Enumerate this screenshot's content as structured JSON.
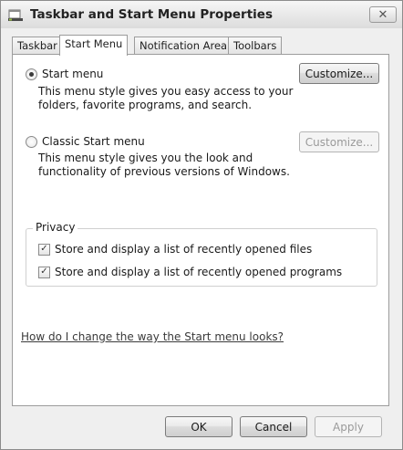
{
  "window": {
    "title": "Taskbar and Start Menu Properties",
    "close_glyph": "✕"
  },
  "tabs": [
    {
      "label": "Taskbar",
      "active": false
    },
    {
      "label": "Start Menu",
      "active": true
    },
    {
      "label": "Notification Area",
      "active": false
    },
    {
      "label": "Toolbars",
      "active": false
    }
  ],
  "start_menu": {
    "option_start": {
      "label": "Start menu",
      "selected": true,
      "description_line1": "This menu style gives you easy access to your",
      "description_line2": "folders, favorite programs, and search.",
      "customize_label": "Customize...",
      "customize_enabled": true
    },
    "option_classic": {
      "label": "Classic Start menu",
      "selected": false,
      "description_line1": "This menu style gives you the look and",
      "description_line2": "functionality of previous versions of Windows.",
      "customize_label": "Customize...",
      "customize_enabled": false
    },
    "privacy": {
      "title": "Privacy",
      "checkboxes": [
        {
          "label": "Store and display a list of recently opened files",
          "checked": true
        },
        {
          "label": "Store and display a list of recently opened programs",
          "checked": true
        }
      ]
    },
    "help_link": "How do I change the way the Start menu looks?"
  },
  "footer": {
    "ok_label": "OK",
    "cancel_label": "Cancel",
    "apply_label": "Apply",
    "apply_enabled": false
  },
  "icons": {
    "app": "taskbar-properties-icon",
    "check_glyph": "✓"
  }
}
